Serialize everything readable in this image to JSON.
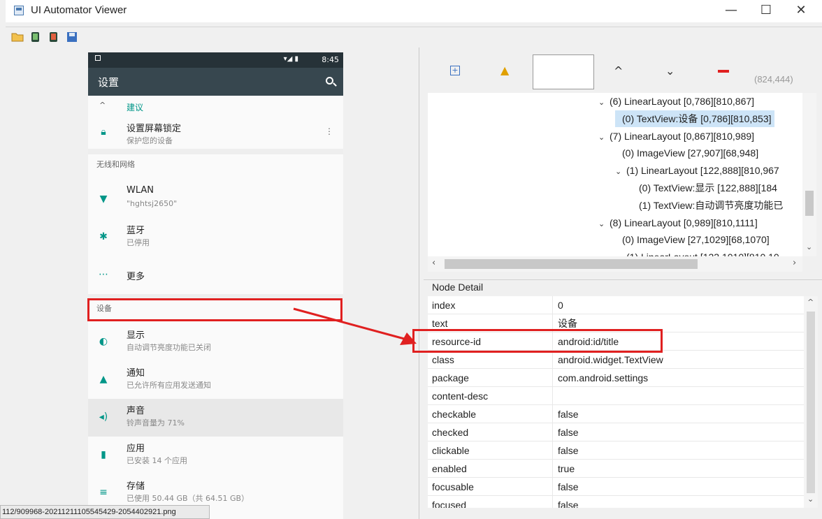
{
  "window": {
    "title": "UI Automator Viewer"
  },
  "window_controls": {
    "minimize": "—",
    "maximize": "☐",
    "close": "✕"
  },
  "phone": {
    "status_time": "8:45",
    "app_title": "设置",
    "suggestion_header": "建议",
    "suggestion": {
      "title": "设置屏幕锁定",
      "subtitle": "保护您的设备"
    },
    "section_wireless": "无线和网络",
    "items_wireless": [
      {
        "title": "WLAN",
        "subtitle": "\"hghtsj2650\""
      },
      {
        "title": "蓝牙",
        "subtitle": "已停用"
      },
      {
        "title": "更多",
        "subtitle": ""
      }
    ],
    "section_device": "设备",
    "items_device": [
      {
        "title": "显示",
        "subtitle": "自动调节亮度功能已关闭"
      },
      {
        "title": "通知",
        "subtitle": "已允许所有应用发送通知"
      },
      {
        "title": "声音",
        "subtitle": "铃声音量为 71%"
      },
      {
        "title": "应用",
        "subtitle": "已安装 14 个应用"
      },
      {
        "title": "存储",
        "subtitle": "已使用 50.44 GB（共 64.51 GB）"
      }
    ]
  },
  "coords": "(824,444)",
  "tree": [
    {
      "text": "(6) LinearLayout [0,786][810,867]",
      "indent": 0,
      "arrow": "⌄"
    },
    {
      "text": "(0) TextView:设备 [0,786][810,853]",
      "indent": 1,
      "arrow": "",
      "selected": true
    },
    {
      "text": "(7) LinearLayout [0,867][810,989]",
      "indent": 0,
      "arrow": "⌄"
    },
    {
      "text": "(0) ImageView [27,907][68,948]",
      "indent": 1,
      "arrow": ""
    },
    {
      "text": "(1) LinearLayout [122,888][810,967",
      "indent": 1,
      "arrow": "⌄"
    },
    {
      "text": "(0) TextView:显示 [122,888][184",
      "indent": 2,
      "arrow": ""
    },
    {
      "text": "(1) TextView:自动调节亮度功能已",
      "indent": 2,
      "arrow": ""
    },
    {
      "text": "(8) LinearLayout [0,989][810,1111]",
      "indent": 0,
      "arrow": "⌄"
    },
    {
      "text": "(0) ImageView [27,1029][68,1070]",
      "indent": 1,
      "arrow": ""
    },
    {
      "text": "(1) LinearLayout [122,1010][810,10",
      "indent": 1,
      "arrow": "⌄"
    }
  ],
  "node_detail": {
    "label": "Node Detail",
    "rows": [
      {
        "key": "index",
        "value": "0"
      },
      {
        "key": "text",
        "value": "设备"
      },
      {
        "key": "resource-id",
        "value": "android:id/title"
      },
      {
        "key": "class",
        "value": "android.widget.TextView"
      },
      {
        "key": "package",
        "value": "com.android.settings"
      },
      {
        "key": "content-desc",
        "value": ""
      },
      {
        "key": "checkable",
        "value": "false"
      },
      {
        "key": "checked",
        "value": "false"
      },
      {
        "key": "clickable",
        "value": "false"
      },
      {
        "key": "enabled",
        "value": "true"
      },
      {
        "key": "focusable",
        "value": "false"
      },
      {
        "key": "focused",
        "value": "false"
      }
    ]
  },
  "status_path": "112/909968-20211211105545429-2054402921.png",
  "colors": {
    "highlight": "#e02020",
    "appbar": "#37474f",
    "statusbar": "#263238",
    "selection": "#cde4f7"
  }
}
